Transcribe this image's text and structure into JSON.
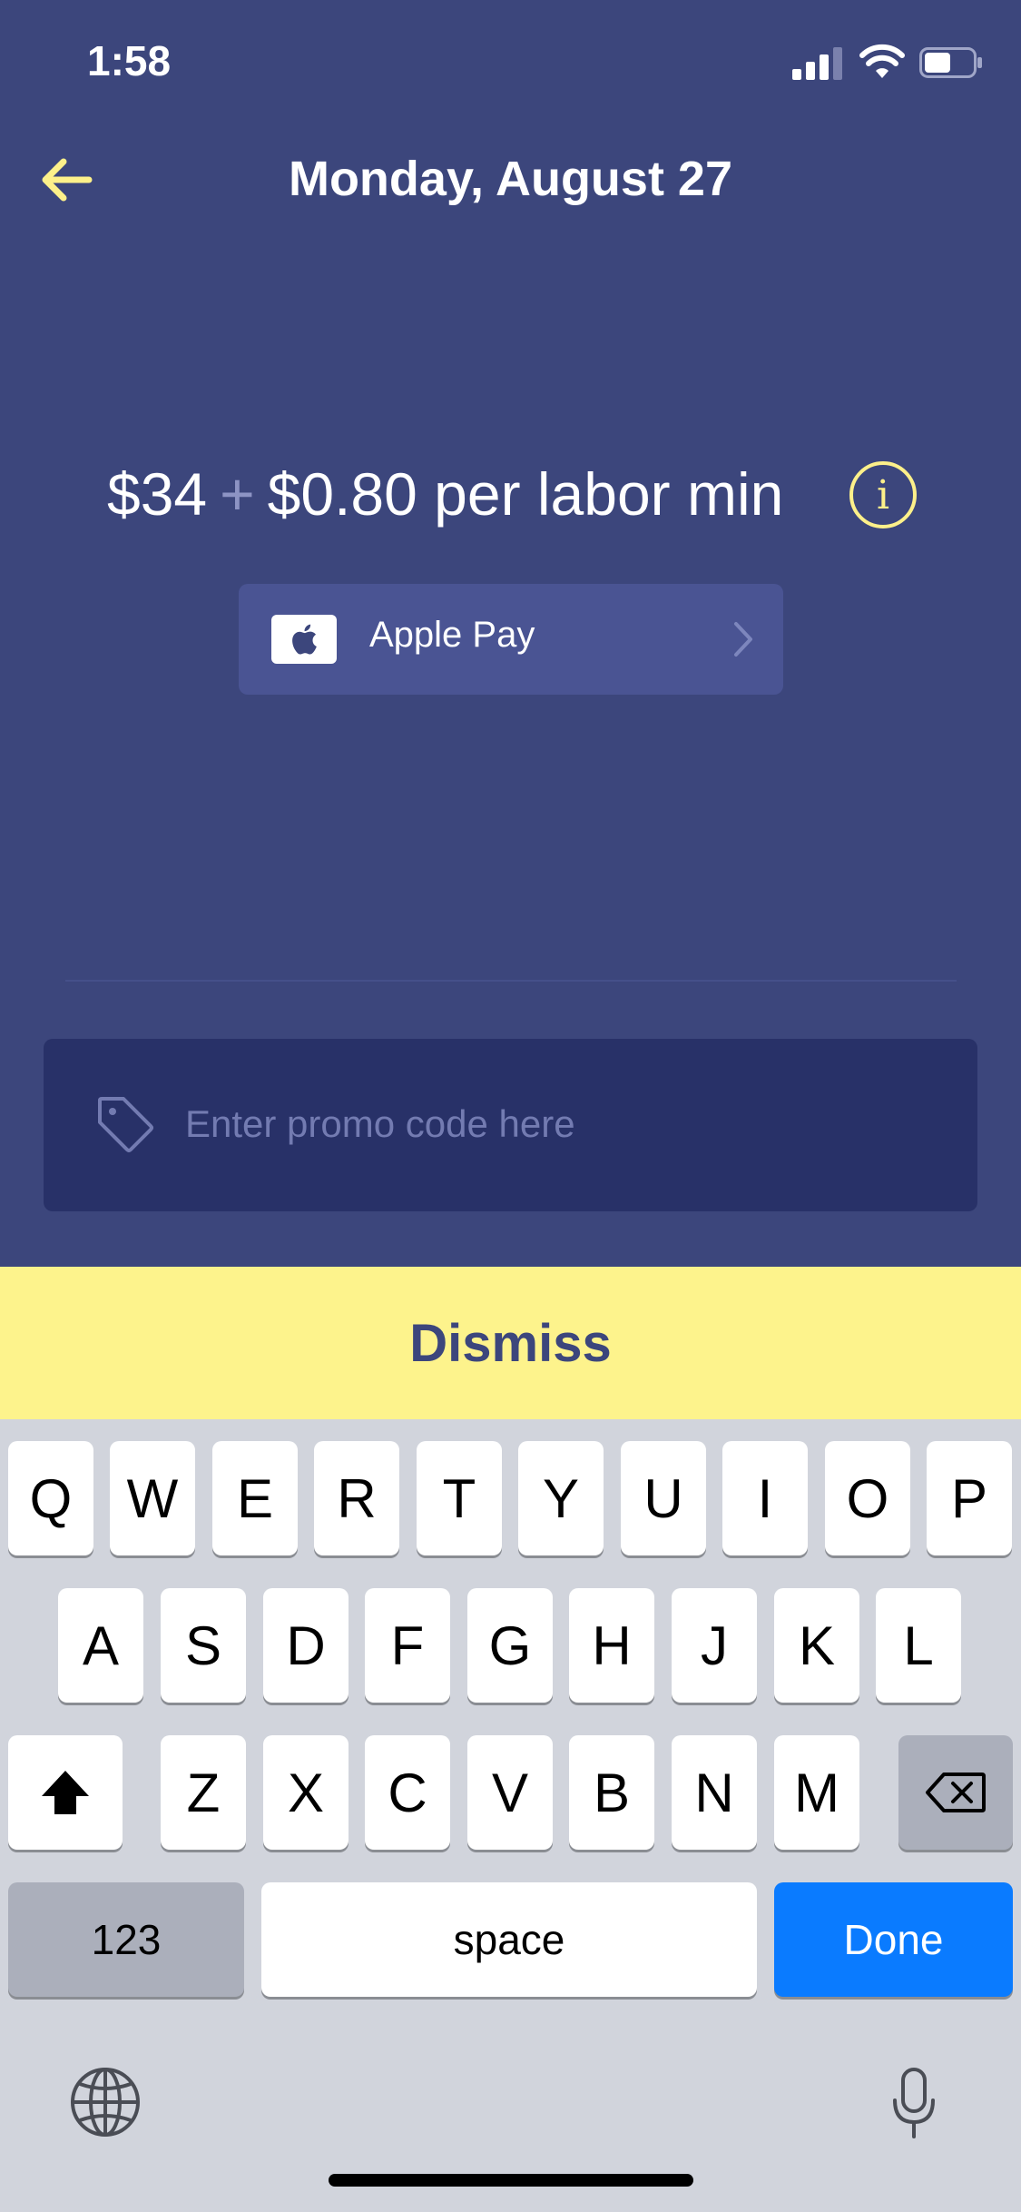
{
  "status_bar": {
    "time": "1:58",
    "icons": [
      "signal-icon",
      "wifi-icon",
      "battery-icon"
    ]
  },
  "header": {
    "title": "Monday, August 27",
    "back_icon": "arrow-left-icon"
  },
  "pricing": {
    "base_price": "$34",
    "plus": "+",
    "rate": "$0.80 per labor min",
    "info_icon": "i"
  },
  "payment": {
    "method_label": "Apple Pay",
    "icon": "apple-icon"
  },
  "promo": {
    "placeholder": "Enter promo code here",
    "value": "",
    "icon": "tag-icon"
  },
  "dismiss": {
    "label": "Dismiss"
  },
  "keyboard": {
    "row1": [
      "Q",
      "W",
      "E",
      "R",
      "T",
      "Y",
      "U",
      "I",
      "O",
      "P"
    ],
    "row2": [
      "A",
      "S",
      "D",
      "F",
      "G",
      "H",
      "J",
      "K",
      "L"
    ],
    "row3": [
      "Z",
      "X",
      "C",
      "V",
      "B",
      "N",
      "M"
    ],
    "numbers_label": "123",
    "space_label": "space",
    "done_label": "Done"
  },
  "colors": {
    "background": "#3c467c",
    "accent_yellow": "#fdf38c",
    "promo_field": "#283168",
    "done_blue": "#0a7bff"
  }
}
